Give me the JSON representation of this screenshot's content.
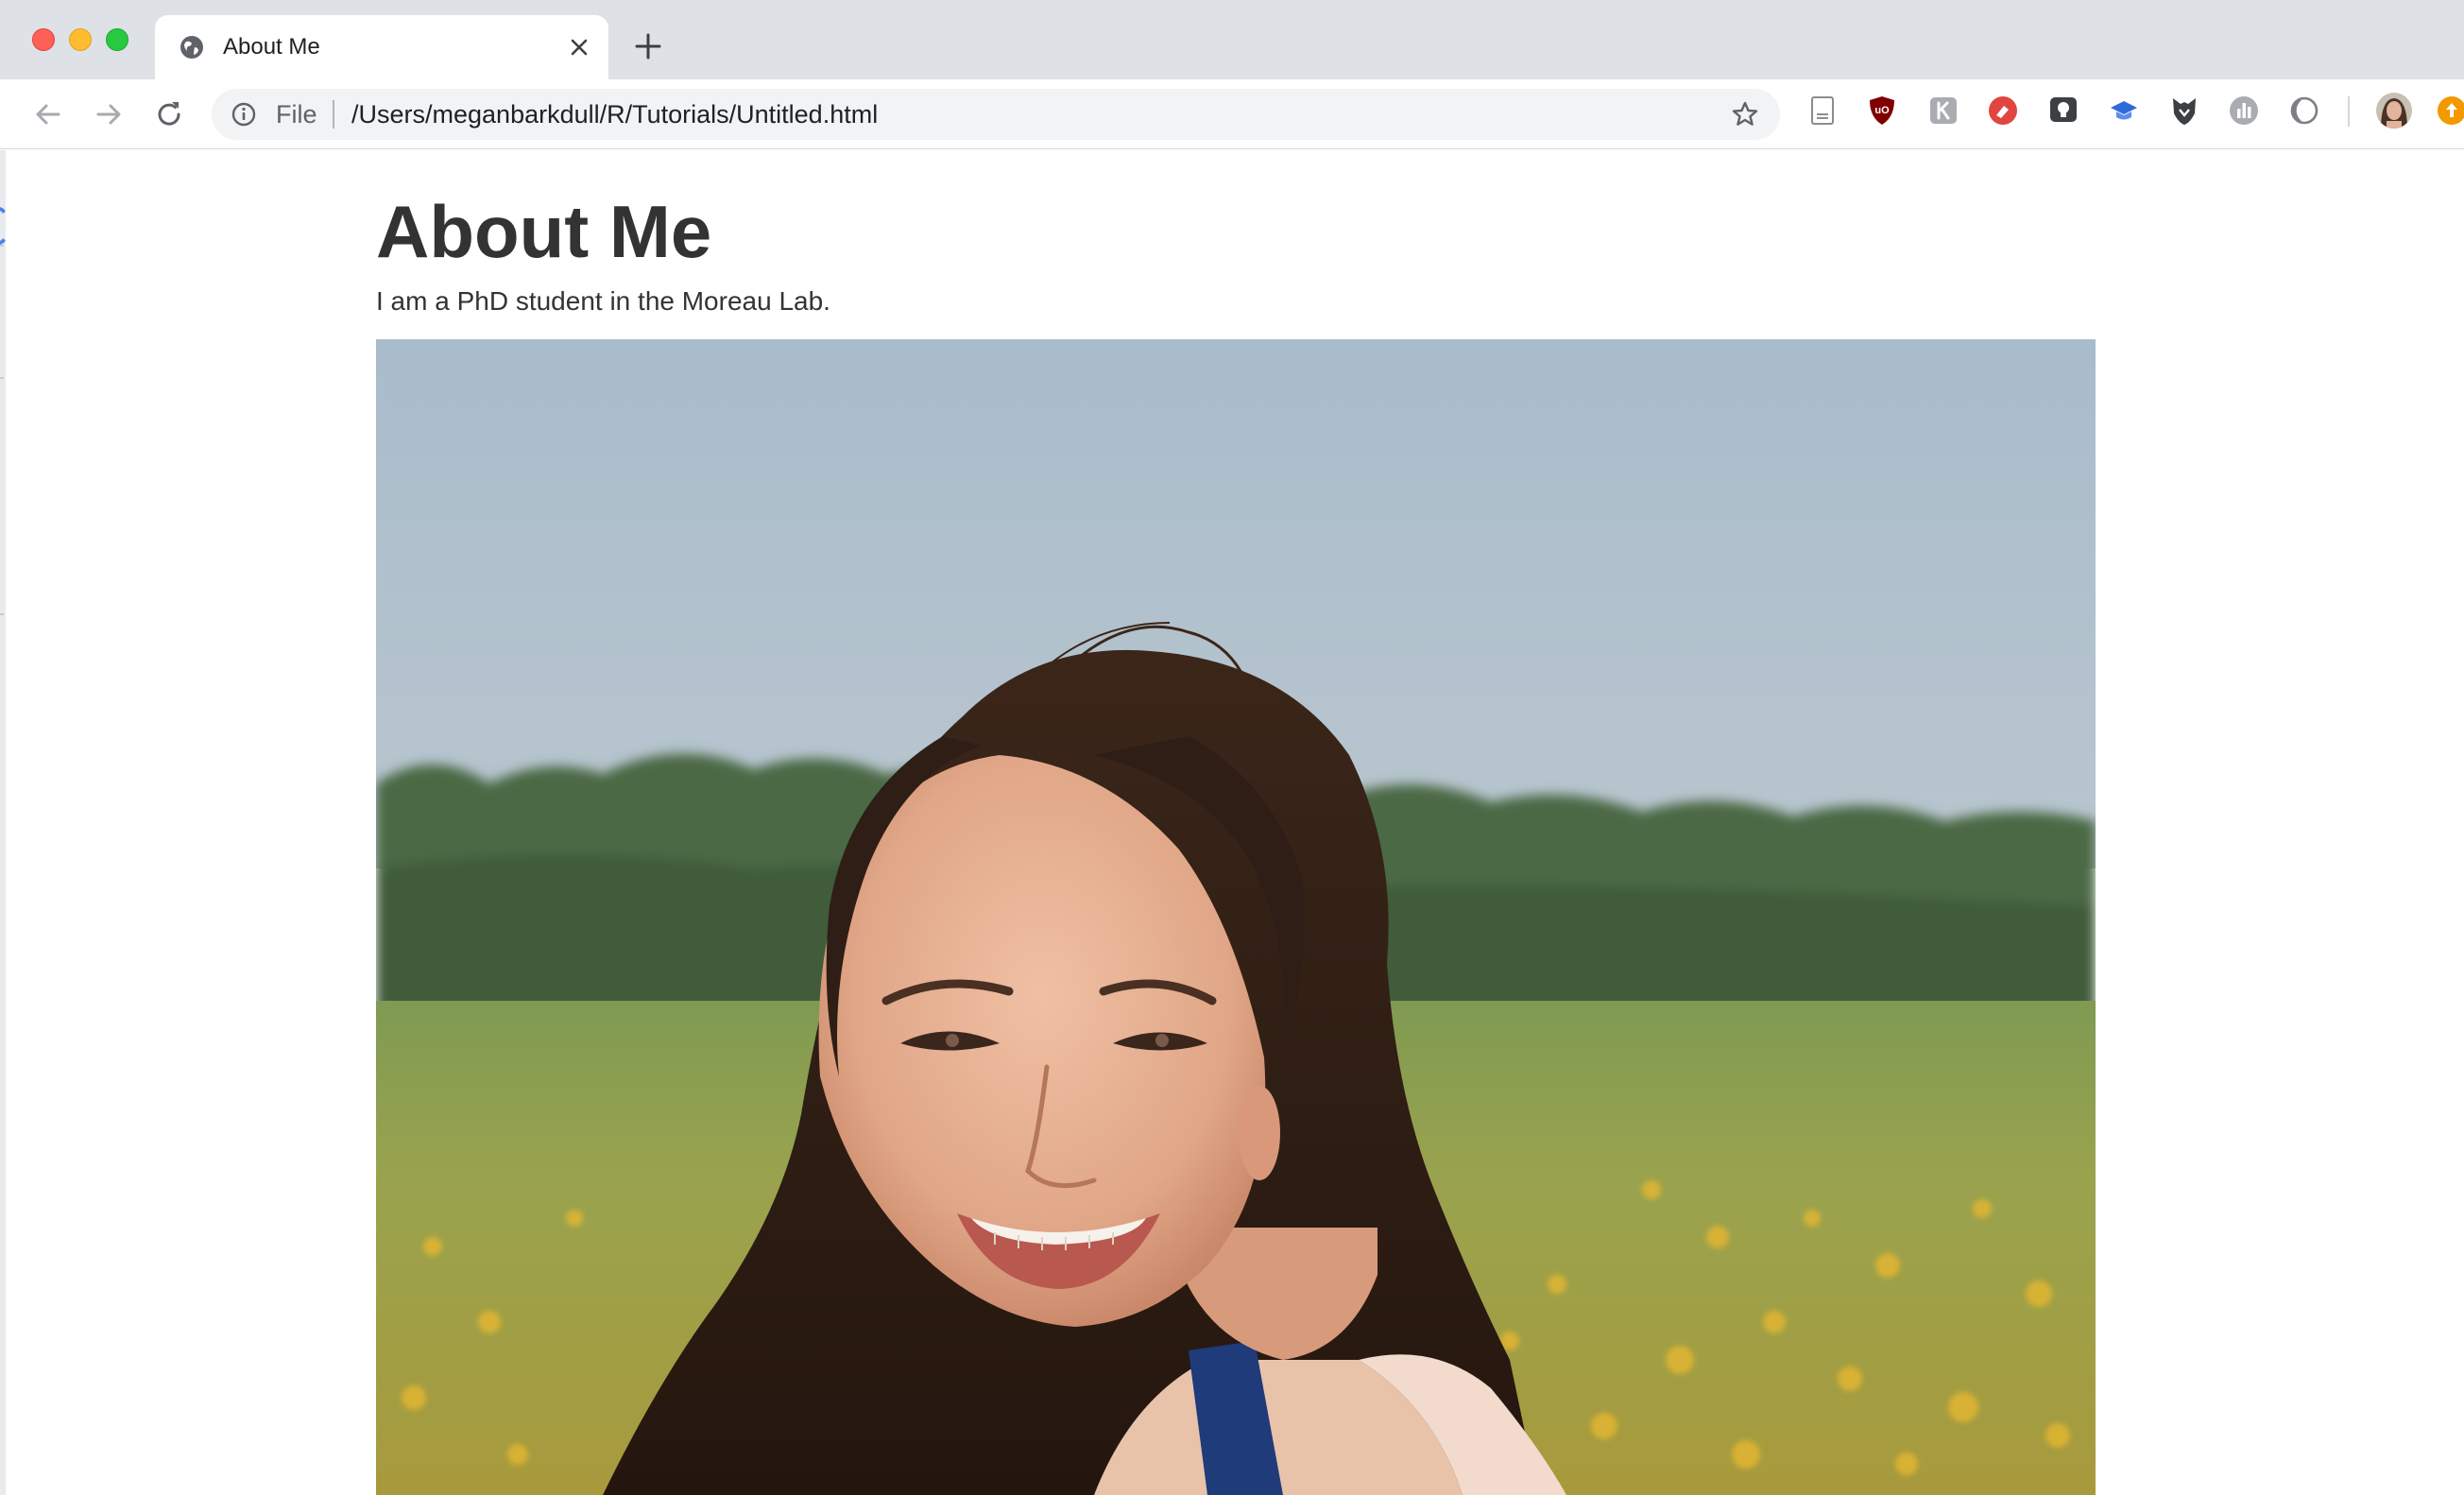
{
  "window": {
    "controls": [
      "close",
      "minimize",
      "zoom"
    ]
  },
  "tab": {
    "title": "About Me",
    "favicon": "globe-icon",
    "close_icon": "close-icon"
  },
  "new_tab_icon": "plus-icon",
  "toolbar": {
    "back_icon": "back-arrow-icon",
    "forward_icon": "forward-arrow-icon",
    "reload_icon": "reload-icon",
    "omnibox": {
      "info_icon": "info-icon",
      "scheme": "File",
      "url": "/Users/meganbarkdull/R/Tutorials/Untitled.html",
      "bookmark_icon": "star-icon"
    },
    "extensions": [
      "page-icon",
      "ublock-shield-icon",
      "letter-k-icon",
      "red-extension-icon",
      "lightbulb-icon",
      "graduation-cap-icon",
      "fox-shield-icon",
      "bar-chart-icon",
      "moon-icon",
      "profile-avatar",
      "orange-update-icon"
    ]
  },
  "page": {
    "heading": "About Me",
    "intro": "I am a PhD student in the Moreau Lab.",
    "photo": {
      "subject": "smiling woman with long dark hair in a meadow",
      "colors": {
        "sky": "#aebfcb",
        "trees": "#4f6a45",
        "grass": "#8fa04d",
        "flowers": "#e0b52e",
        "hair": "#2e1e15",
        "skin": "#e3ab8e"
      }
    }
  },
  "colors": {
    "tabstrip": "#dee1e6",
    "omnibox": "#f1f3f4",
    "text_primary": "#333333",
    "accent_blue": "#4a84e8"
  }
}
